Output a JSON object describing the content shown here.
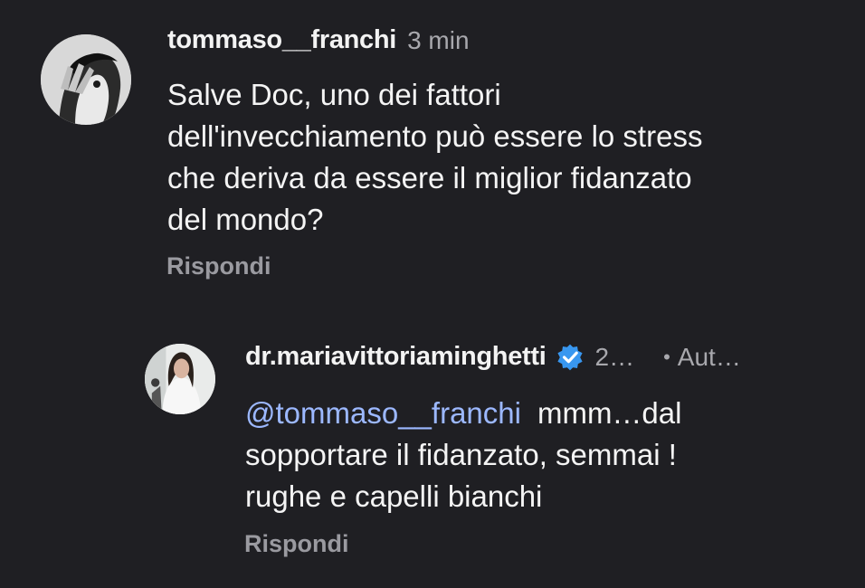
{
  "comments": [
    {
      "username": "tommaso__franchi",
      "time": "3 min",
      "lines": [
        "Salve Doc, uno dei fattori",
        "dell'invecchiamento può essere lo stress",
        "che deriva da essere il miglior fidanzato",
        "del mondo?"
      ],
      "reply_label": "Rispondi",
      "avatar_icon": "user-avatar-photo"
    }
  ],
  "reply": {
    "username": "dr.mariavittoriaminghetti",
    "verified": true,
    "time": "2…",
    "separator": "•",
    "author_label": "Aut…",
    "mention": "@tommaso__franchi",
    "first_line_text": "mmm…dal",
    "lines": [
      "sopportare il fidanzato, semmai !",
      "rughe e capelli bianchi"
    ],
    "reply_label": "Rispondi",
    "avatar_icon": "user-avatar-photo"
  },
  "colors": {
    "background": "#1f1f23",
    "mention": "#9cb8ff",
    "verified_badge": "#3897f0",
    "muted_text": "#a8a8ad"
  }
}
